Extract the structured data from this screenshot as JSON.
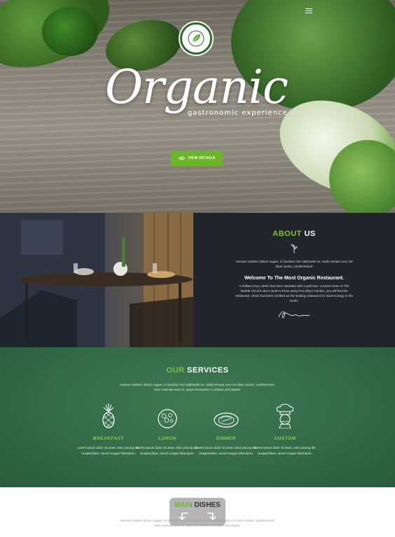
{
  "hero": {
    "title": "Organic",
    "subtitle": "gastronomic experience",
    "button_label": "VIEW DETAILS"
  },
  "about": {
    "heading_accent": "ABOUT",
    "heading_rest": "US",
    "intro": "Aenean sodales dictum augue, in faucibus nisi sollicitudin eu. Nulla semper arcu vel diam auctor, condimentum",
    "intro_2": "vel diam auctor, condimentum.",
    "subheading": "Welcome To The Most Organic Restaurant.",
    "body": "A brilliant story, which has been awarded with a gold star. Located close to The Marble Church and a stone's throw away from Ørg's Garden, you will find the restaurant, which has been certified as the leading restaurant for local ecology in the North."
  },
  "services": {
    "heading_accent": "OUR",
    "heading_rest": "SERVICES",
    "intro": "Aenean sodales dictum augue, in faucibus nisi sollicitudin eu. Nulla semper arcu vel diam auctor, condimentum.",
    "intro_2": "Nam molestie sem ex, quam fermentum a tempus sed aliquet.",
    "items": [
      {
        "name": "BREAKFAST",
        "text": "Lorem ipsum dolor sit amet, tetur piscing elit. Suspendisse, amod congue bibendum."
      },
      {
        "name": "LUNCH",
        "text": "Lorem ipsum dolor sit amet, tetur piscing elit. Suspendisse, amod congue bibendum."
      },
      {
        "name": "DINNER",
        "text": "Lorem ipsum dolor sit amet, tetur piscing elit. Suspendisse, amod congue bibendum."
      },
      {
        "name": "CUSTOM",
        "text": "Lorem ipsum dolor sit amet, tetur piscing elit. Suspendisse, amod congue bibendum."
      }
    ]
  },
  "dishes": {
    "heading_accent": "MAIN",
    "heading_rest": "DISHES",
    "intro": "Aenean sodales dictum augue, in faucibus nisi sollicitudin eu. Nulla semper arcu vel diam auctor, condimentum.",
    "intro_2": "Nam molestie sem ex, quam fermentum a tempus sed aliquet."
  },
  "colors": {
    "accent_green": "#6bb52a",
    "services_bg": "#336a48",
    "about_bg": "#22262c"
  },
  "icons": [
    "menu-icon",
    "leaf-logo-icon",
    "eye-icon",
    "herb-icon",
    "signature-icon",
    "pineapple-icon",
    "salad-bowl-icon",
    "dinner-plate-icon",
    "chef-icon",
    "scroll-arrow-icon"
  ]
}
